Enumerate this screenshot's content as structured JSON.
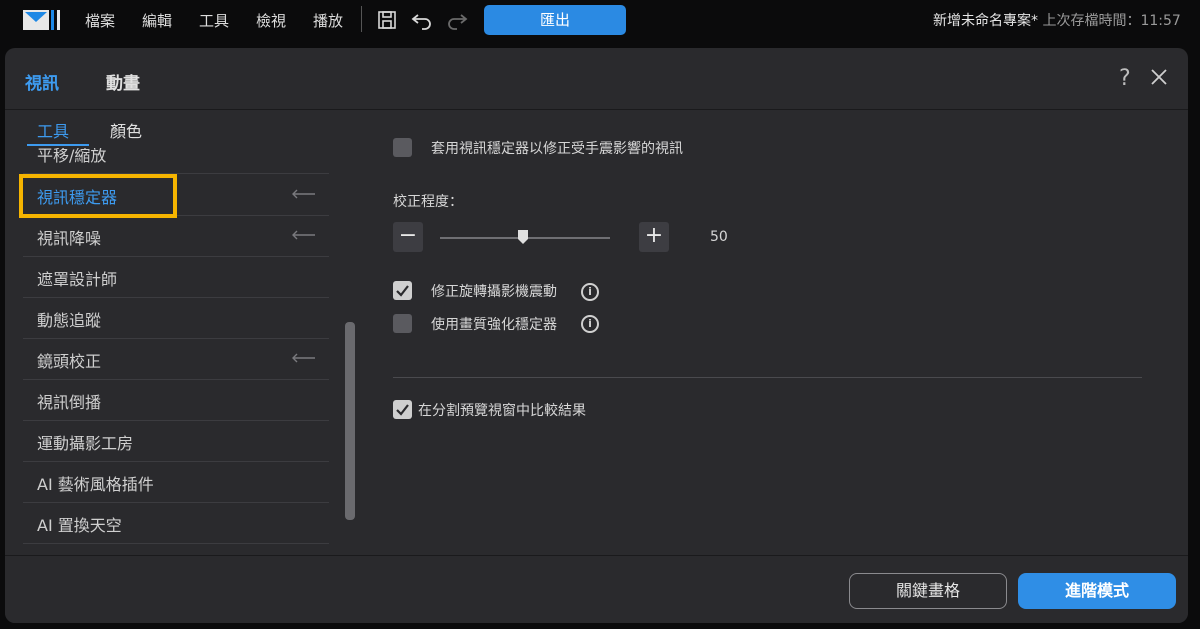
{
  "menubar": {
    "items": [
      "檔案",
      "編輯",
      "工具",
      "檢視",
      "播放"
    ],
    "export_label": "匯出",
    "project_title": "新增未命名專案*",
    "last_saved": "上次存檔時間：11:57"
  },
  "dialog": {
    "tabs": [
      "視訊",
      "動畫"
    ],
    "help_glyph": "?",
    "sub_tabs": [
      "工具",
      "顏色"
    ],
    "tool_items": [
      {
        "label": "平移/縮放",
        "reset": false
      },
      {
        "label": "視訊穩定器",
        "reset": true,
        "selected": true
      },
      {
        "label": "視訊降噪",
        "reset": true
      },
      {
        "label": "遮罩設計師",
        "reset": false
      },
      {
        "label": "動態追蹤",
        "reset": false
      },
      {
        "label": "鏡頭校正",
        "reset": true
      },
      {
        "label": "視訊倒播",
        "reset": false
      },
      {
        "label": "運動攝影工房",
        "reset": false
      },
      {
        "label": "AI 藝術風格插件",
        "reset": false
      },
      {
        "label": "AI 置換天空",
        "reset": false
      }
    ],
    "panel": {
      "apply_stabilizer": {
        "label": "套用視訊穩定器以修正受手震影響的視訊",
        "checked": false
      },
      "correction_label": "校正程度：",
      "correction_value": "50",
      "correction_level": 0.5,
      "minus_glyph": "−",
      "plus_glyph": "+",
      "fix_rolling": {
        "label": "修正旋轉攝影機震動",
        "checked": true
      },
      "enhanced": {
        "label": "使用畫質強化穩定器",
        "checked": false
      },
      "compare_split": {
        "label": "在分割預覽視窗中比較結果",
        "checked": true
      }
    },
    "footer": {
      "keyframe_label": "關鍵畫格",
      "advanced_label": "進階模式"
    }
  },
  "colors": {
    "accent": "#3d9bf0",
    "highlight": "#f5b400",
    "button_primary": "#2f8ee6"
  }
}
